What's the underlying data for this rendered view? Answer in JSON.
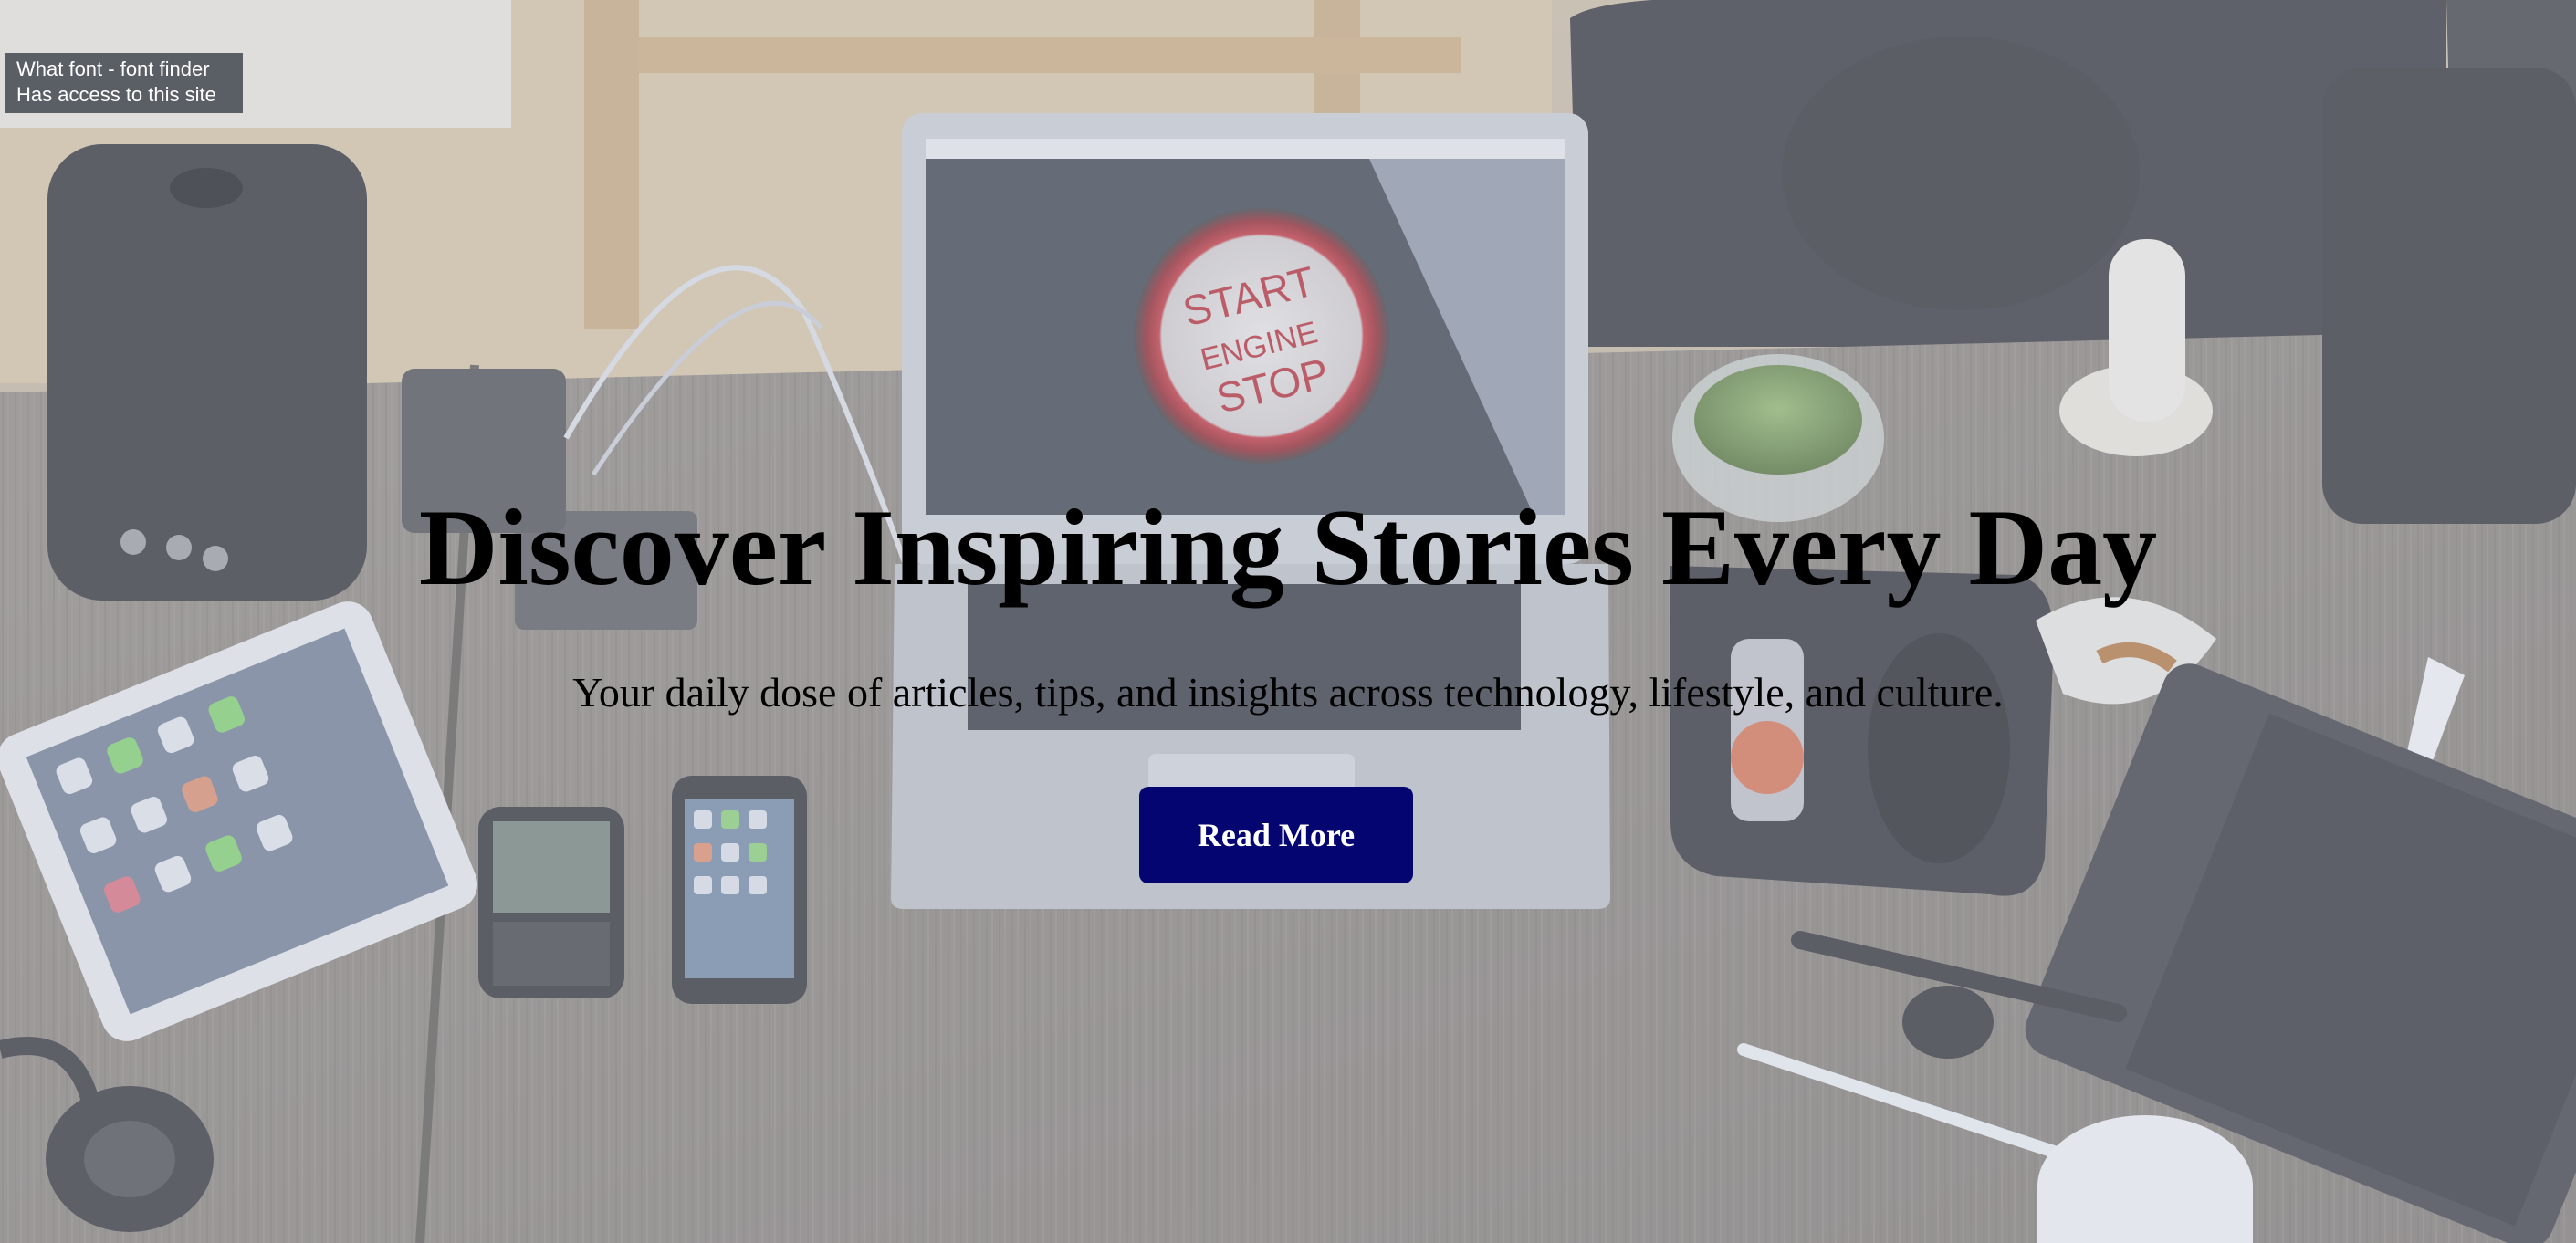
{
  "tooltip": {
    "line1": "What font - font finder",
    "line2": "Has access to this site"
  },
  "hero": {
    "background": "workspace-desk-photo",
    "laptop_screen": {
      "line1": "START",
      "line2": "ENGINE",
      "line3": "STOP"
    },
    "title": "Discover Inspiring Stories Every Day",
    "subtitle": "Your daily dose of articles, tips, and insights across technology, lifestyle, and culture.",
    "cta_label": "Read More"
  },
  "colors": {
    "cta_background": "#050572",
    "cta_text": "#ffffff",
    "title_text": "#000000",
    "tooltip_background": "#4e525a"
  }
}
